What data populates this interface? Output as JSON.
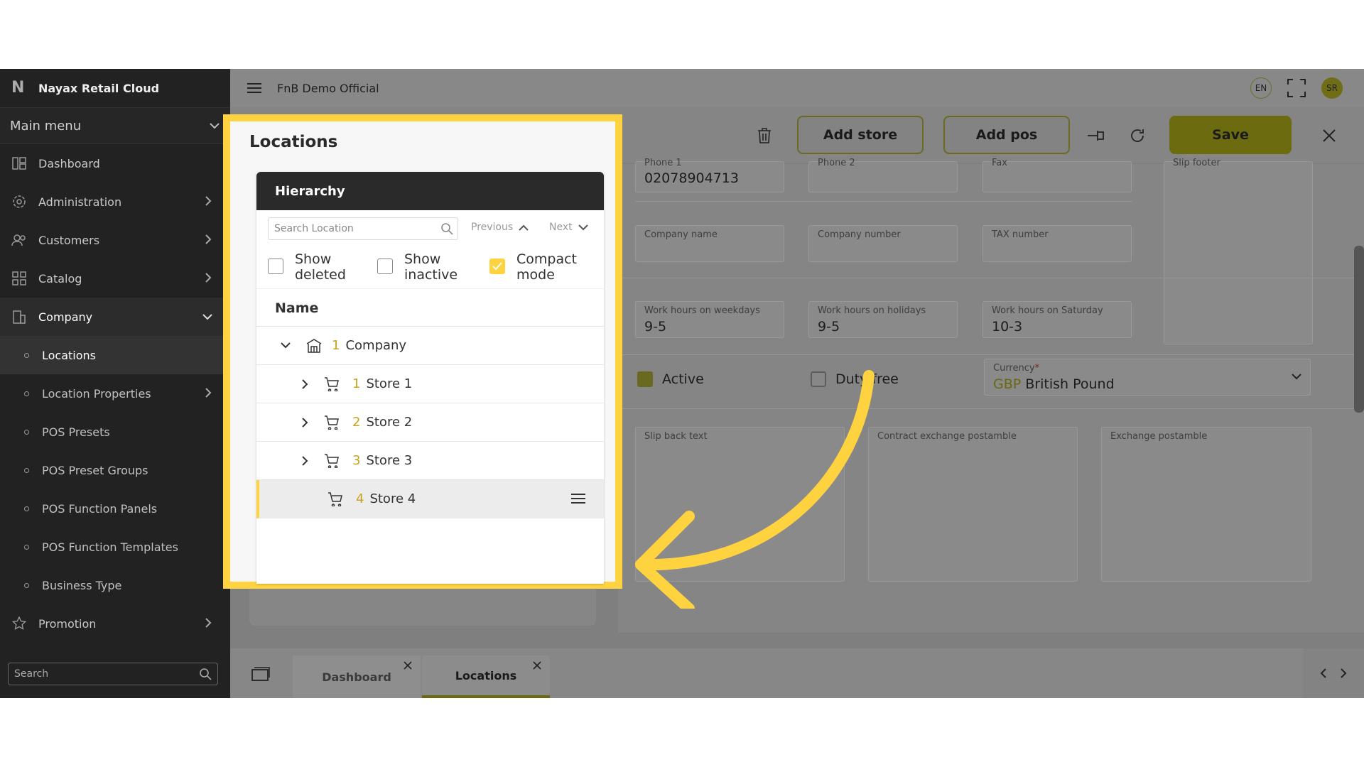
{
  "app": {
    "name": "Nayax Retail Cloud",
    "org": "FnB Demo Official"
  },
  "sidebar": {
    "main_menu": "Main menu",
    "items": [
      {
        "label": "Dashboard",
        "icon": "dashboard-icon"
      },
      {
        "label": "Administration",
        "icon": "settings-gear-icon"
      },
      {
        "label": "Customers",
        "icon": "customers-icon"
      },
      {
        "label": "Catalog",
        "icon": "catalog-grid-icon"
      },
      {
        "label": "Company",
        "icon": "building-icon"
      }
    ],
    "sub_items": [
      {
        "label": "Locations"
      },
      {
        "label": "Location Properties"
      },
      {
        "label": "POS Presets"
      },
      {
        "label": "POS Preset Groups"
      },
      {
        "label": "POS Function Panels"
      },
      {
        "label": "POS Function Templates"
      },
      {
        "label": "Business Type"
      }
    ],
    "promotion": "Promotion",
    "search_placeholder": "Search"
  },
  "topbar": {
    "lang": "EN",
    "avatar": "SR"
  },
  "toolbar": {
    "add_store": "Add store",
    "add_pos": "Add pos",
    "save": "Save"
  },
  "form": {
    "phone1_label": "Phone 1",
    "phone1_value": "02078904713",
    "phone2_label": "Phone 2",
    "fax_label": "Fax",
    "slip_footer_label": "Slip footer",
    "company_name_label": "Company name",
    "company_number_label": "Company number",
    "tax_number_label": "TAX number",
    "weekdays_label": "Work hours on weekdays",
    "weekdays_value": "9-5",
    "holidays_label": "Work hours on holidays",
    "holidays_value": "9-5",
    "saturday_label": "Work hours on Saturday",
    "saturday_value": "10-3",
    "active_label": "Active",
    "duty_free_label": "Duty free",
    "currency_label": "Currency",
    "currency_required": "*",
    "currency_code": "GBP",
    "currency_name": "British Pound",
    "slip_back_label": "Slip back text",
    "contract_label": "Contract exchange postamble",
    "exchange_label": "Exchange postamble"
  },
  "locations": {
    "title": "Locations",
    "hierarchy": "Hierarchy",
    "search_placeholder": "Search Location",
    "previous": "Previous",
    "next": "Next",
    "opt_deleted": [
      "Show",
      "deleted"
    ],
    "opt_inactive": [
      "Show",
      "inactive"
    ],
    "opt_compact": [
      "Compact",
      "mode"
    ],
    "compact_checked": true,
    "name_col": "Name",
    "tree": [
      {
        "num": "1",
        "label": "Company",
        "type": "company"
      },
      {
        "num": "1",
        "label": "Store 1",
        "type": "store"
      },
      {
        "num": "2",
        "label": "Store 2",
        "type": "store"
      },
      {
        "num": "3",
        "label": "Store 3",
        "type": "store"
      },
      {
        "num": "4",
        "label": "Store 4",
        "type": "store"
      }
    ]
  },
  "tabs": [
    {
      "label": "Dashboard"
    },
    {
      "label": "Locations"
    }
  ],
  "colors": {
    "accent": "#ffd23f",
    "sidebar": "#222222"
  }
}
